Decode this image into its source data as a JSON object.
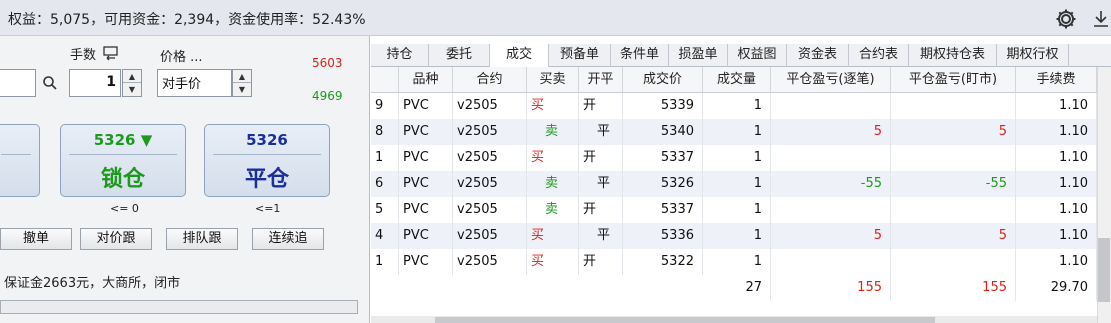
{
  "account": {
    "summary": "权益：5,075，可用资金：2,394，资金使用率：52.43%"
  },
  "toolbar": {
    "settings_icon": "gear-icon",
    "download_icon": "download-icon"
  },
  "order": {
    "qty_label": "手数",
    "price_label": "价格 ...",
    "qty_value": "1",
    "price_value": "对手价",
    "ask": "5603",
    "bid": "4969",
    "ask_color": "#e0201a",
    "bid_color": "#1c9a1c"
  },
  "big_buttons": [
    {
      "price": "5326 ▼",
      "label": "锁仓",
      "note": "<= 0",
      "color": "#1c9a1c"
    },
    {
      "price": "5326",
      "label": "平仓",
      "note": "<=1",
      "color": "#1a2f9a"
    }
  ],
  "actions": [
    "撤单",
    "对价跟",
    "排队跟",
    "连续追"
  ],
  "status": "保证金2663元，大商所，闭市",
  "tabs": [
    "持仓",
    "委托",
    "成交",
    "预备单",
    "条件单",
    "损盈单",
    "权益图",
    "资金表",
    "合约表",
    "期权持仓表",
    "期权行权"
  ],
  "active_tab": "成交",
  "columns": [
    "品种",
    "合约",
    "买卖",
    "开平",
    "成交价",
    "成交量",
    "平仓盈亏(逐笔)",
    "平仓盈亏(盯市)",
    "手续费"
  ],
  "trades": [
    {
      "no": "9",
      "product": "PVC",
      "contract": "v2505",
      "side": "买",
      "oc": "开",
      "price": "5339",
      "volume": "1",
      "pl_trade": "",
      "pl_mtm": "",
      "fee": "1.10"
    },
    {
      "no": "8",
      "product": "PVC",
      "contract": "v2505",
      "side": "卖",
      "oc": "平",
      "price": "5340",
      "volume": "1",
      "pl_trade": "5",
      "pl_mtm": "5",
      "fee": "1.10"
    },
    {
      "no": "1",
      "product": "PVC",
      "contract": "v2505",
      "side": "买",
      "oc": "开",
      "price": "5337",
      "volume": "1",
      "pl_trade": "",
      "pl_mtm": "",
      "fee": "1.10"
    },
    {
      "no": "6",
      "product": "PVC",
      "contract": "v2505",
      "side": "卖",
      "oc": "平",
      "price": "5326",
      "volume": "1",
      "pl_trade": "-55",
      "pl_mtm": "-55",
      "fee": "1.10"
    },
    {
      "no": "5",
      "product": "PVC",
      "contract": "v2505",
      "side": "卖",
      "oc": "开",
      "price": "5337",
      "volume": "1",
      "pl_trade": "",
      "pl_mtm": "",
      "fee": "1.10"
    },
    {
      "no": "4",
      "product": "PVC",
      "contract": "v2505",
      "side": "买",
      "oc": "平",
      "price": "5336",
      "volume": "1",
      "pl_trade": "5",
      "pl_mtm": "5",
      "fee": "1.10"
    },
    {
      "no": "1",
      "product": "PVC",
      "contract": "v2505",
      "side": "买",
      "oc": "开",
      "price": "5322",
      "volume": "1",
      "pl_trade": "",
      "pl_mtm": "",
      "fee": "1.10"
    }
  ],
  "totals": {
    "volume": "27",
    "pl_trade": "155",
    "pl_mtm": "155",
    "fee": "29.70"
  }
}
